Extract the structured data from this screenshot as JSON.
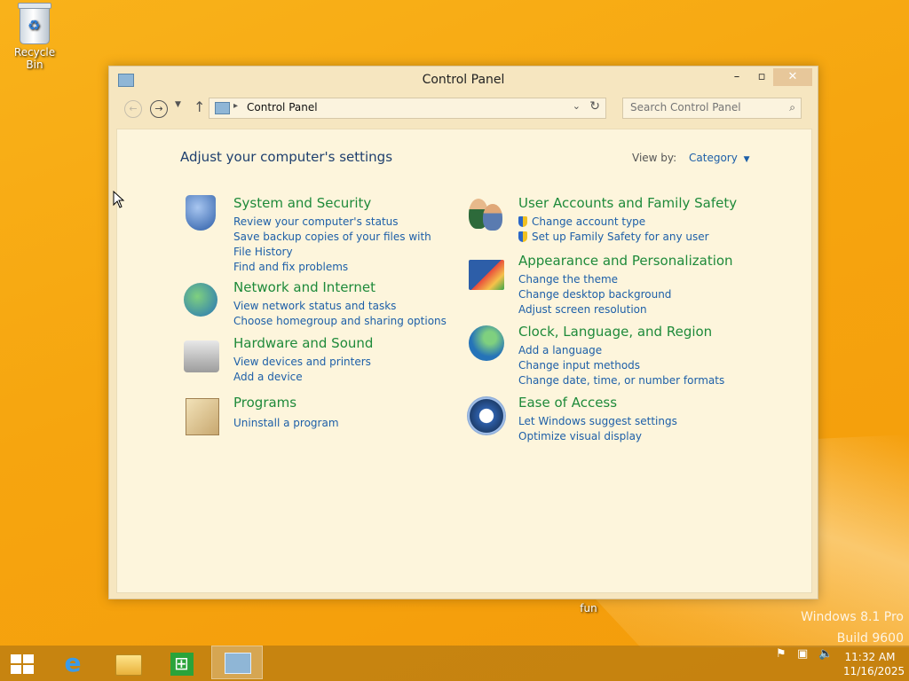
{
  "desktop": {
    "icons": [
      {
        "label": "Recycle Bin"
      },
      {
        "label": "fun"
      }
    ],
    "watermark": {
      "line1": "Windows 8.1 Pro",
      "line2": "Build 9600"
    }
  },
  "window": {
    "title": "Control Panel",
    "controls": {
      "minimize": "–",
      "maximize": "▫",
      "close": "✕"
    },
    "address": {
      "crumb": "Control Panel"
    },
    "search": {
      "placeholder": "Search Control Panel"
    },
    "heading": "Adjust your computer's settings",
    "view_by": {
      "label": "View by:",
      "value": "Category"
    },
    "categories_left": [
      {
        "title": "System and Security",
        "icon": "shield-icon",
        "links": [
          "Review your computer's status",
          "Save backup copies of your files with File History",
          "Find and fix problems"
        ]
      },
      {
        "title": "Network and Internet",
        "icon": "network-globe-icon",
        "links": [
          "View network status and tasks",
          "Choose homegroup and sharing options"
        ]
      },
      {
        "title": "Hardware and Sound",
        "icon": "printer-speaker-icon",
        "links": [
          "View devices and printers",
          "Add a device"
        ]
      },
      {
        "title": "Programs",
        "icon": "programs-box-icon",
        "links": [
          "Uninstall a program"
        ]
      }
    ],
    "categories_right": [
      {
        "title": "User Accounts and Family Safety",
        "icon": "users-icon",
        "links": [
          "Change account type",
          "Set up Family Safety for any user"
        ]
      },
      {
        "title": "Appearance and Personalization",
        "icon": "appearance-icon",
        "links": [
          "Change the theme",
          "Change desktop background",
          "Adjust screen resolution"
        ]
      },
      {
        "title": "Clock, Language, and Region",
        "icon": "clock-globe-icon",
        "links": [
          "Add a language",
          "Change input methods",
          "Change date, time, or number formats"
        ]
      },
      {
        "title": "Ease of Access",
        "icon": "ease-of-access-icon",
        "links": [
          "Let Windows suggest settings",
          "Optimize visual display"
        ]
      }
    ]
  },
  "taskbar": {
    "clock": {
      "time": "11:32 AM",
      "date": "11/16/2025"
    }
  }
}
